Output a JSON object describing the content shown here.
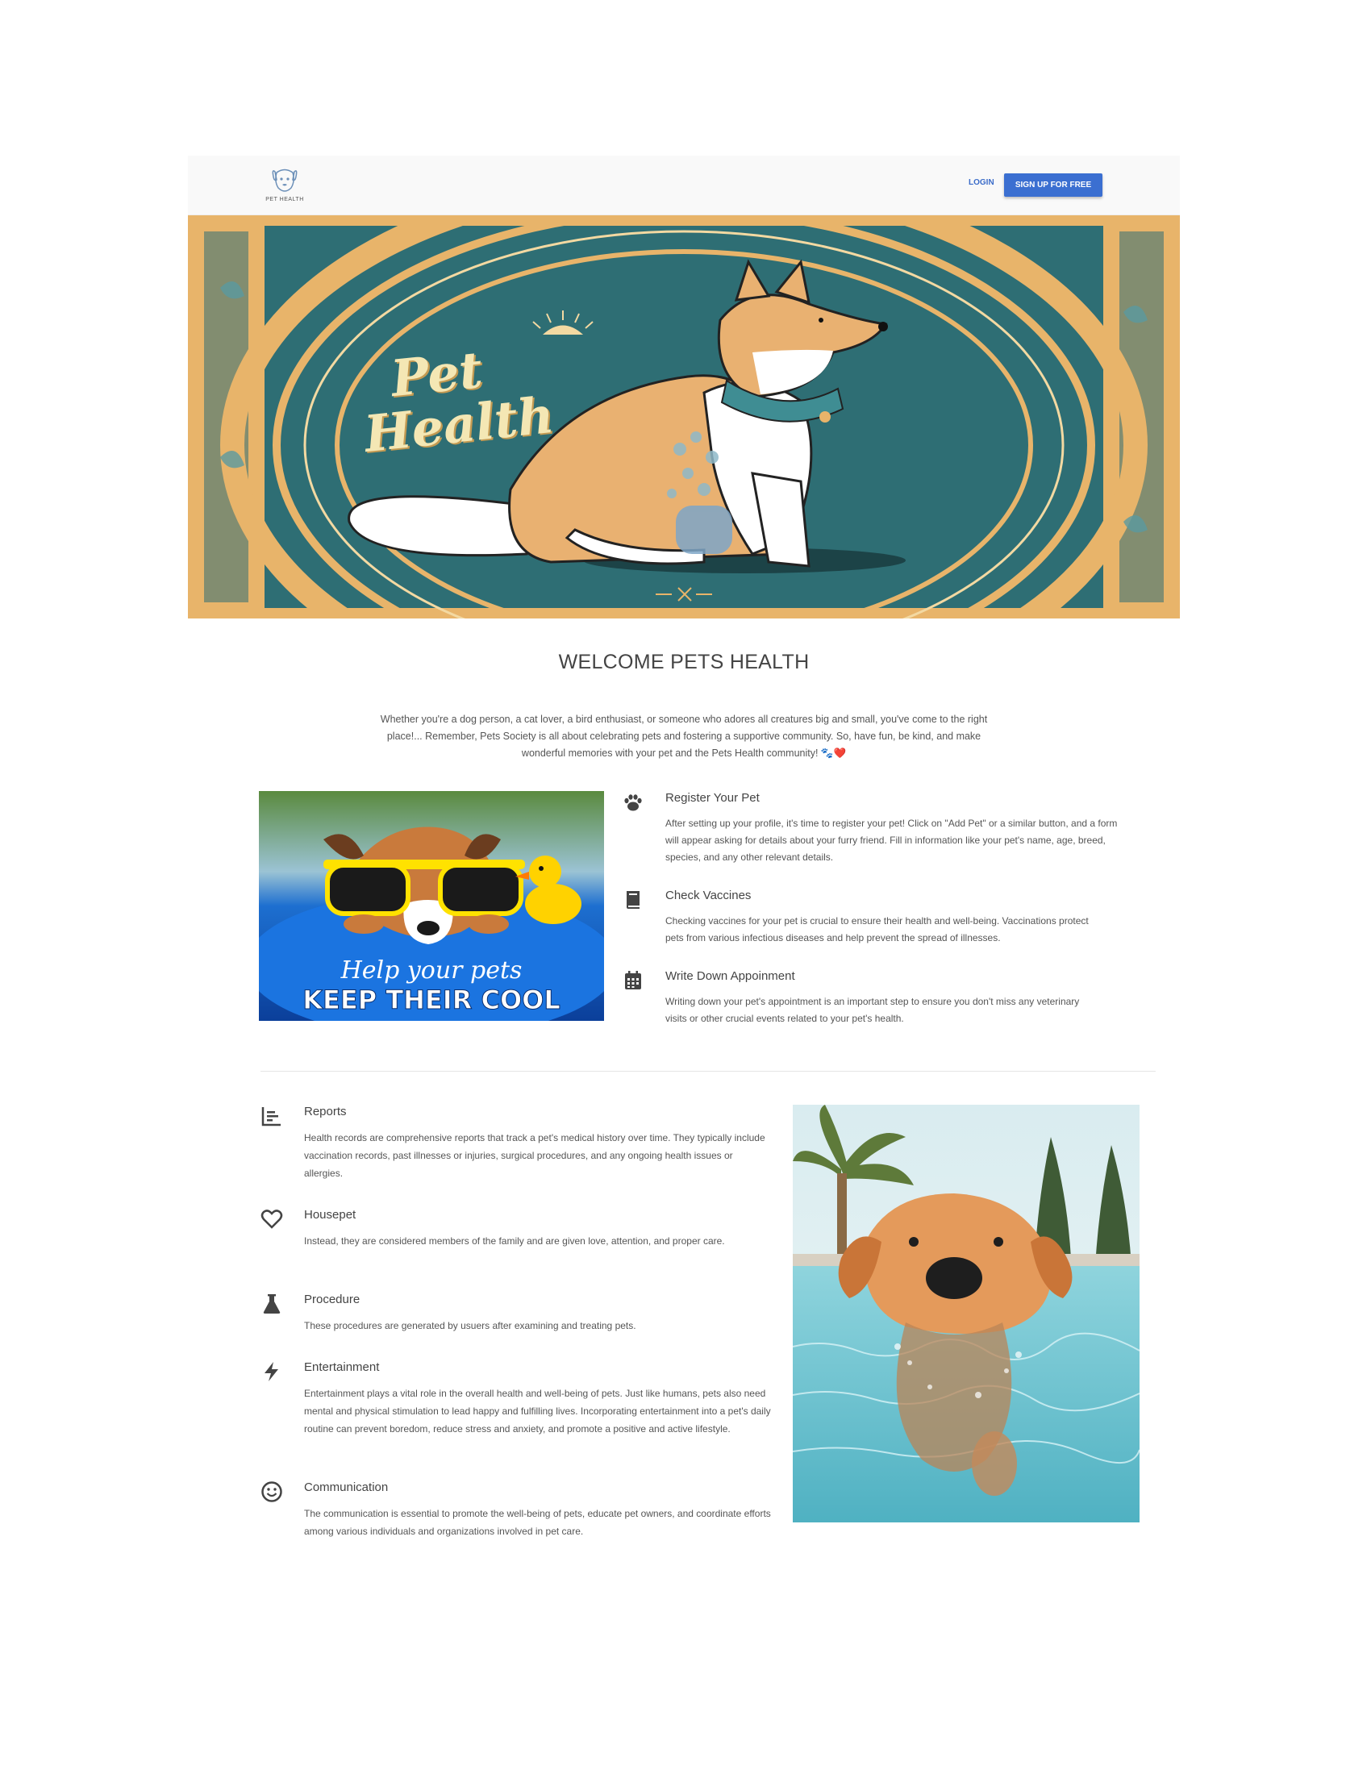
{
  "header": {
    "logo_text": "PET HEALTH",
    "login_label": "LOGIN",
    "signup_label": "SIGN UP FOR FREE"
  },
  "hero": {
    "title_line1": "Pet",
    "title_line2": "Health"
  },
  "welcome": {
    "title": "WELCOME PETS HEALTH",
    "text": "Whether you're a dog person, a cat lover, a bird enthusiast, or someone who adores all creatures big and small, you've come to the right place!... Remember, Pets Society is all about celebrating pets and fostering a supportive community. So, have fun, be kind, and make wonderful memories with your pet and the Pets Health community! 🐾❤️"
  },
  "features_top": {
    "image_caption_line1": "Help your pets",
    "image_caption_line2": "KEEP THEIR COOL",
    "items": [
      {
        "icon": "paw-icon",
        "title": "Register Your Pet",
        "text": "After setting up your profile, it's time to register your pet! Click on \"Add Pet\" or a similar button, and a form will appear asking for details about your furry friend. Fill in information like your pet's name, age, breed, species, and any other relevant details."
      },
      {
        "icon": "book-icon",
        "title": "Check Vaccines",
        "text": "Checking vaccines for your pet is crucial to ensure their health and well-being. Vaccinations protect pets from various infectious diseases and help prevent the spread of illnesses."
      },
      {
        "icon": "calendar-icon",
        "title": "Write Down Appoinment",
        "text": "Writing down your pet's appointment is an important step to ensure you don't miss any veterinary visits or other crucial events related to your pet's health."
      }
    ]
  },
  "features_bottom": {
    "items": [
      {
        "icon": "bar-chart-icon",
        "title": "Reports",
        "text": "Health records are comprehensive reports that track a pet's medical history over time. They typically include vaccination records, past illnesses or injuries, surgical procedures, and any ongoing health issues or allergies."
      },
      {
        "icon": "heart-icon",
        "title": "Housepet",
        "text": "Instead, they are considered members of the family and are given love, attention, and proper care."
      },
      {
        "icon": "flask-icon",
        "title": "Procedure",
        "text": "These procedures are generated by usuers after examining and treating pets."
      },
      {
        "icon": "bolt-icon",
        "title": "Entertainment",
        "text": "Entertainment plays a vital role in the overall health and well-being of pets. Just like humans, pets also need mental and physical stimulation to lead happy and fulfilling lives. Incorporating entertainment into a pet's daily routine can prevent boredom, reduce stress and anxiety, and promote a positive and active lifestyle."
      },
      {
        "icon": "smiley-icon",
        "title": "Communication",
        "text": "The communication is essential to promote the well-being of pets, educate pet owners, and coordinate efforts among various individuals and organizations involved in pet care."
      }
    ]
  }
}
